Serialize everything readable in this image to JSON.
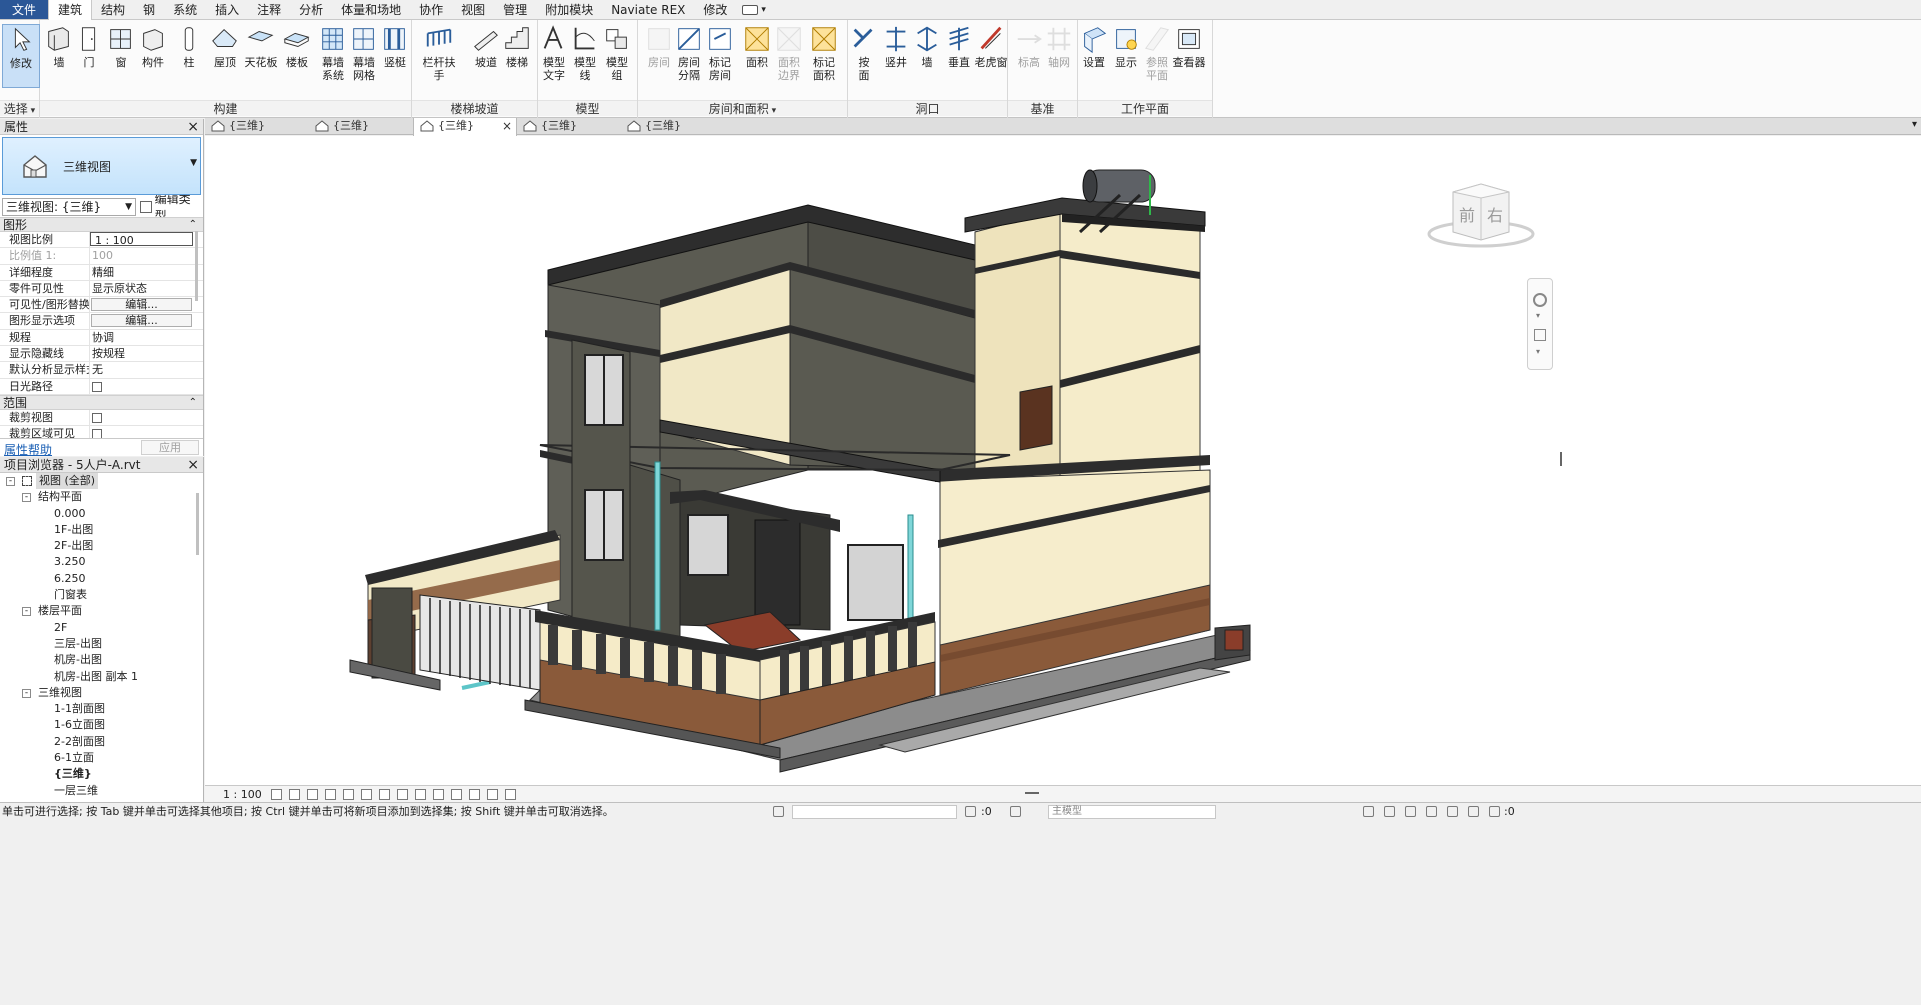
{
  "menu": {
    "tabs": [
      "文件",
      "建筑",
      "结构",
      "钢",
      "系统",
      "插入",
      "注释",
      "分析",
      "体量和场地",
      "协作",
      "视图",
      "管理",
      "附加模块",
      "Naviate REX",
      "修改"
    ],
    "active_index": 1
  },
  "ribbon": {
    "panels": [
      {
        "title": "选择",
        "has_dropdown": true
      },
      {
        "title": "构建"
      },
      {
        "title": "楼梯坡道"
      },
      {
        "title": "模型"
      },
      {
        "title": "房间和面积",
        "has_dropdown": true
      },
      {
        "title": "洞口"
      },
      {
        "title": "基准"
      },
      {
        "title": "工作平面"
      }
    ],
    "buttons": [
      {
        "label": "修改",
        "icon": "cursor-arrow-icon"
      },
      {
        "label": "墙",
        "icon": "wall-icon"
      },
      {
        "label": "门",
        "icon": "door-icon"
      },
      {
        "label": "窗",
        "icon": "window-icon"
      },
      {
        "label": "构件",
        "icon": "component-icon"
      },
      {
        "label": "柱",
        "icon": "column-icon"
      },
      {
        "label": "屋顶",
        "icon": "roof-icon"
      },
      {
        "label": "天花板",
        "icon": "ceiling-icon"
      },
      {
        "label": "楼板",
        "icon": "floor-icon"
      },
      {
        "label": "幕墙\n系统",
        "icon": "curtain-system-icon"
      },
      {
        "label": "幕墙\n网格",
        "icon": "curtain-grid-icon"
      },
      {
        "label": "竖梃",
        "icon": "mullion-icon"
      },
      {
        "label": "栏杆扶手",
        "icon": "railing-icon"
      },
      {
        "label": "坡道",
        "icon": "ramp-icon"
      },
      {
        "label": "楼梯",
        "icon": "stair-icon"
      },
      {
        "label": "模型\n文字",
        "icon": "model-text-icon"
      },
      {
        "label": "模型\n线",
        "icon": "model-line-icon"
      },
      {
        "label": "模型\n组",
        "icon": "model-group-icon"
      },
      {
        "label": "房间",
        "icon": "room-icon",
        "disabled": true
      },
      {
        "label": "房间\n分隔",
        "icon": "room-separator-icon"
      },
      {
        "label": "标记\n房间",
        "icon": "tag-room-icon"
      },
      {
        "label": "面积",
        "icon": "area-icon"
      },
      {
        "label": "面积\n边界",
        "icon": "area-boundary-icon",
        "disabled": true
      },
      {
        "label": "标记\n面积",
        "icon": "tag-area-icon"
      },
      {
        "label": "按\n面",
        "icon": "by-face-icon"
      },
      {
        "label": "竖井",
        "icon": "shaft-icon"
      },
      {
        "label": "墙",
        "icon": "wall-opening-icon"
      },
      {
        "label": "垂直",
        "icon": "vertical-opening-icon"
      },
      {
        "label": "老虎窗",
        "icon": "dormer-icon"
      },
      {
        "label": "标高",
        "icon": "level-icon",
        "disabled": true
      },
      {
        "label": "轴网",
        "icon": "grid-icon",
        "disabled": true
      },
      {
        "label": "设置",
        "icon": "set-workplane-icon"
      },
      {
        "label": "显示",
        "icon": "show-workplane-icon"
      },
      {
        "label": "参照\n平面",
        "icon": "ref-plane-icon",
        "disabled": true
      },
      {
        "label": "查看器",
        "icon": "viewer-icon"
      }
    ]
  },
  "properties": {
    "title": "属性",
    "type_name": "三维视图",
    "view_selector": "三维视图: {三维}",
    "edit_type": "编辑类型",
    "sections": [
      {
        "name": "图形",
        "rows": [
          {
            "key": "视图比例",
            "value": "1 : 100",
            "style": "input"
          },
          {
            "key": "比例值 1:",
            "value": "100",
            "style": "dim"
          },
          {
            "key": "详细程度",
            "value": "精细"
          },
          {
            "key": "零件可见性",
            "value": "显示原状态"
          },
          {
            "key": "可见性/图形替换",
            "value": "编辑...",
            "style": "button"
          },
          {
            "key": "图形显示选项",
            "value": "编辑...",
            "style": "button"
          },
          {
            "key": "规程",
            "value": "协调"
          },
          {
            "key": "显示隐藏线",
            "value": "按规程"
          },
          {
            "key": "默认分析显示样式",
            "value": "无"
          },
          {
            "key": "日光路径",
            "value": "",
            "style": "checkbox"
          }
        ]
      },
      {
        "name": "范围",
        "rows": [
          {
            "key": "裁剪视图",
            "value": "",
            "style": "checkbox"
          },
          {
            "key": "裁剪区域可见",
            "value": "",
            "style": "checkbox"
          }
        ]
      }
    ],
    "help": "属性帮助",
    "apply": "应用"
  },
  "browser": {
    "title": "项目浏览器 - 5人户-A.rvt",
    "nodes": [
      {
        "label": "视图 (全部)",
        "level": 0,
        "toggle": "-",
        "icon": true
      },
      {
        "label": "结构平面",
        "level": 1,
        "toggle": "-"
      },
      {
        "label": "0.000",
        "level": 2
      },
      {
        "label": "1F-出图",
        "level": 2
      },
      {
        "label": "2F-出图",
        "level": 2
      },
      {
        "label": "3.250",
        "level": 2
      },
      {
        "label": "6.250",
        "level": 2
      },
      {
        "label": "门窗表",
        "level": 2
      },
      {
        "label": "楼层平面",
        "level": 1,
        "toggle": "-"
      },
      {
        "label": "2F",
        "level": 2
      },
      {
        "label": "三层-出图",
        "level": 2
      },
      {
        "label": "机房-出图",
        "level": 2
      },
      {
        "label": "机房-出图 副本 1",
        "level": 2
      },
      {
        "label": "三维视图",
        "level": 1,
        "toggle": "-"
      },
      {
        "label": "1-1剖面图",
        "level": 2
      },
      {
        "label": "1-6立面图",
        "level": 2
      },
      {
        "label": "2-2剖面图",
        "level": 2
      },
      {
        "label": "6-1立面",
        "level": 2
      },
      {
        "label": "{三维}",
        "level": 2,
        "bold": true
      },
      {
        "label": "一层三维",
        "level": 2
      }
    ]
  },
  "view_tabs": [
    {
      "label": "{三维}",
      "active": false
    },
    {
      "label": "{三维}",
      "active": false
    },
    {
      "label": "{三维}",
      "active": true
    },
    {
      "label": "{三维}",
      "active": false
    },
    {
      "label": "{三维}",
      "active": false
    }
  ],
  "viewcube": {
    "front": "前",
    "right": "右"
  },
  "view_control_bar": {
    "scale": "1 : 100"
  },
  "status": {
    "message": "单击可进行选择; 按 Tab 键并单击可选择其他项目; 按 Ctrl 键并单击可将新项目添加到选择集; 按 Shift 键并单击可取消选择。",
    "selection_count": ":0",
    "model": "主模型",
    "filter_count": ":0"
  },
  "colors": {
    "accent": "#2b5797",
    "selection": "#c9e0f7",
    "wall_cream": "#f5eccb",
    "wall_dark": "#5e5e55",
    "trim": "#3b3b3b",
    "stone": "#8a5a3a"
  }
}
